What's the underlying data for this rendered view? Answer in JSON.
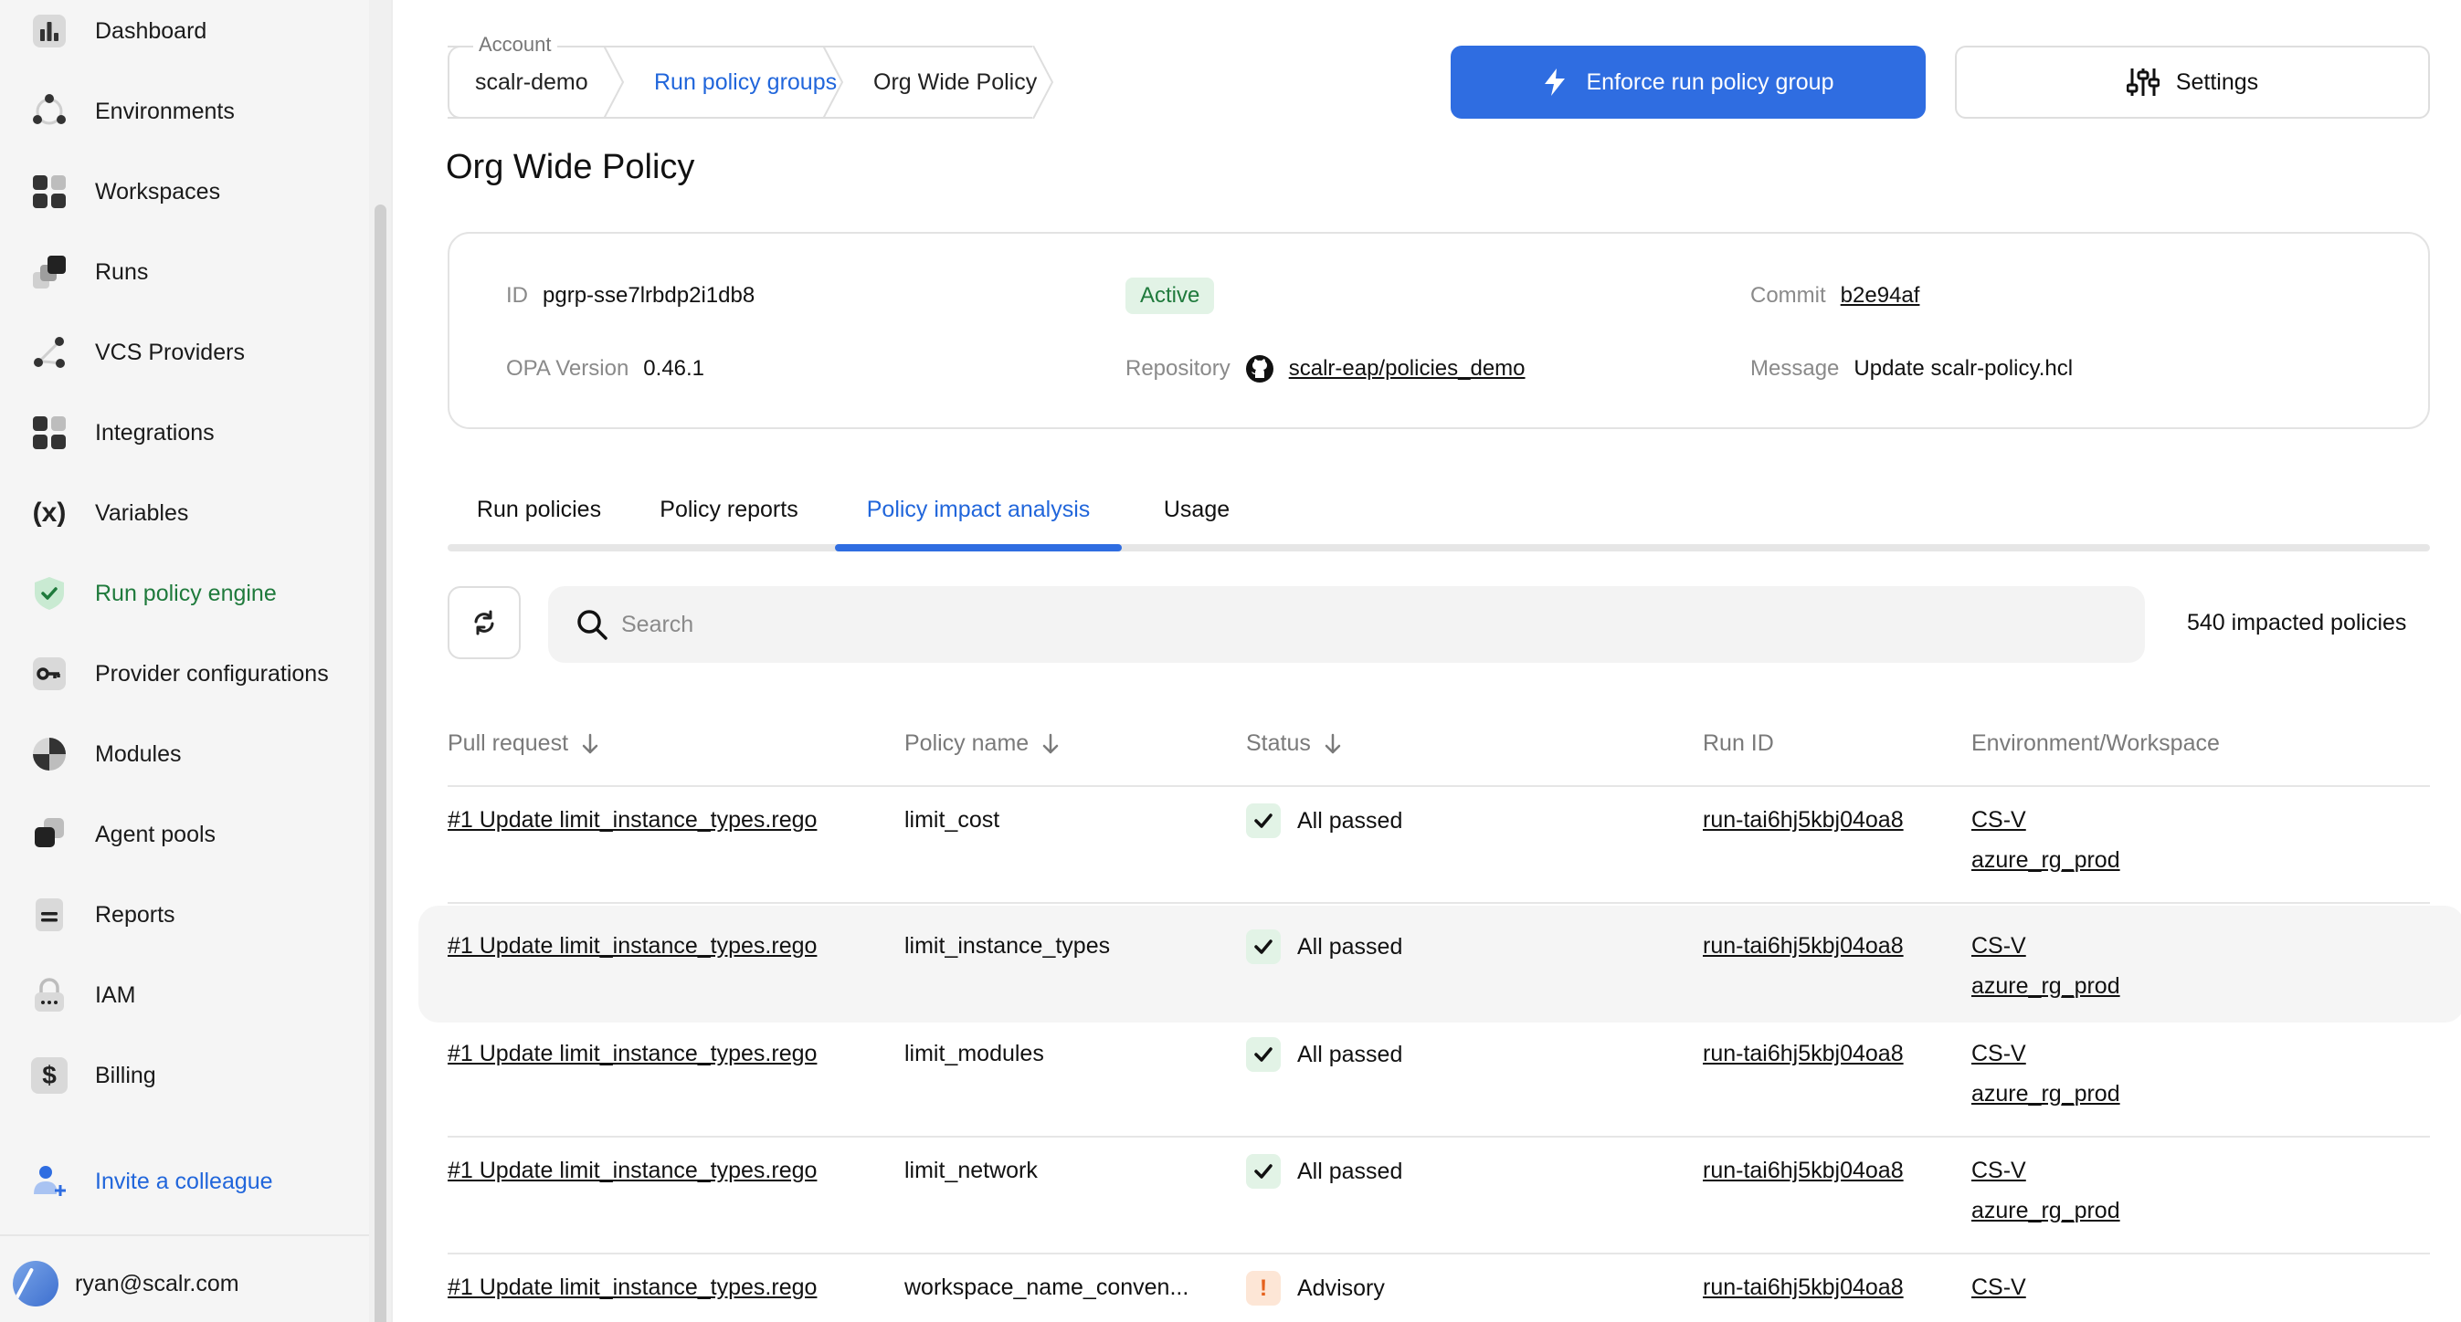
{
  "sidebar": {
    "items": [
      {
        "label": "Dashboard",
        "icon": "dashboard-icon"
      },
      {
        "label": "Environments",
        "icon": "environments-icon"
      },
      {
        "label": "Workspaces",
        "icon": "workspaces-icon"
      },
      {
        "label": "Runs",
        "icon": "runs-icon"
      },
      {
        "label": "VCS Providers",
        "icon": "vcs-icon"
      },
      {
        "label": "Integrations",
        "icon": "integrations-icon"
      },
      {
        "label": "Variables",
        "icon": "variables-icon",
        "glyph": "(x)"
      },
      {
        "label": "Run policy engine",
        "icon": "shield-check-icon",
        "active": true
      },
      {
        "label": "Provider configurations",
        "icon": "key-icon"
      },
      {
        "label": "Modules",
        "icon": "modules-icon"
      },
      {
        "label": "Agent pools",
        "icon": "agent-pools-icon"
      },
      {
        "label": "Reports",
        "icon": "reports-icon"
      },
      {
        "label": "IAM",
        "icon": "lock-icon"
      },
      {
        "label": "Billing",
        "icon": "billing-icon",
        "glyph": "$"
      }
    ],
    "invite_label": "Invite a colleague",
    "user_email": "ryan@scalr.com",
    "active_color": "#1f7a3c",
    "link_color": "#2166db"
  },
  "breadcrumb": {
    "account_label": "Account",
    "items": [
      "scalr-demo",
      "Run policy groups",
      "Org Wide Policy"
    ]
  },
  "actions": {
    "enforce_label": "Enforce run policy group",
    "settings_label": "Settings",
    "primary_color": "#2f6de1"
  },
  "page": {
    "title": "Org Wide Policy"
  },
  "info": {
    "id_label": "ID",
    "id_value": "pgrp-sse7lrbdp2i1db8",
    "status": "Active",
    "commit_label": "Commit",
    "commit_value": "b2e94af",
    "opa_label": "OPA Version",
    "opa_value": "0.46.1",
    "repo_label": "Repository",
    "repo_value": "scalr-eap/policies_demo",
    "message_label": "Message",
    "message_value": "Update scalr-policy.hcl"
  },
  "tabs": [
    "Run policies",
    "Policy reports",
    "Policy impact analysis",
    "Usage"
  ],
  "active_tab": "Policy impact analysis",
  "search": {
    "placeholder": "Search",
    "value": ""
  },
  "impact_count": "540 impacted policies",
  "table": {
    "headers": [
      "Pull request",
      "Policy name",
      "Status",
      "Run ID",
      "Environment/Workspace"
    ],
    "rows": [
      {
        "pr": "#1 Update limit_instance_types.rego",
        "policy": "limit_cost",
        "status": "All passed",
        "status_kind": "ok",
        "run_id": "run-tai6hj5kbj04oa8",
        "env": "CS-V",
        "workspace": "azure_rg_prod"
      },
      {
        "pr": "#1 Update limit_instance_types.rego",
        "policy": "limit_instance_types",
        "status": "All passed",
        "status_kind": "ok",
        "run_id": "run-tai6hj5kbj04oa8",
        "env": "CS-V",
        "workspace": "azure_rg_prod"
      },
      {
        "pr": "#1 Update limit_instance_types.rego",
        "policy": "limit_modules",
        "status": "All passed",
        "status_kind": "ok",
        "run_id": "run-tai6hj5kbj04oa8",
        "env": "CS-V",
        "workspace": "azure_rg_prod"
      },
      {
        "pr": "#1 Update limit_instance_types.rego",
        "policy": "limit_network",
        "status": "All passed",
        "status_kind": "ok",
        "run_id": "run-tai6hj5kbj04oa8",
        "env": "CS-V",
        "workspace": "azure_rg_prod"
      },
      {
        "pr": "#1 Update limit_instance_types.rego",
        "policy": "workspace_name_conven...",
        "status": "Advisory",
        "status_kind": "warn",
        "run_id": "run-tai6hj5kbj04oa8",
        "env": "CS-V",
        "workspace": ""
      }
    ],
    "ok_color": "#1f7a3c",
    "warn_color": "#e5611d"
  }
}
